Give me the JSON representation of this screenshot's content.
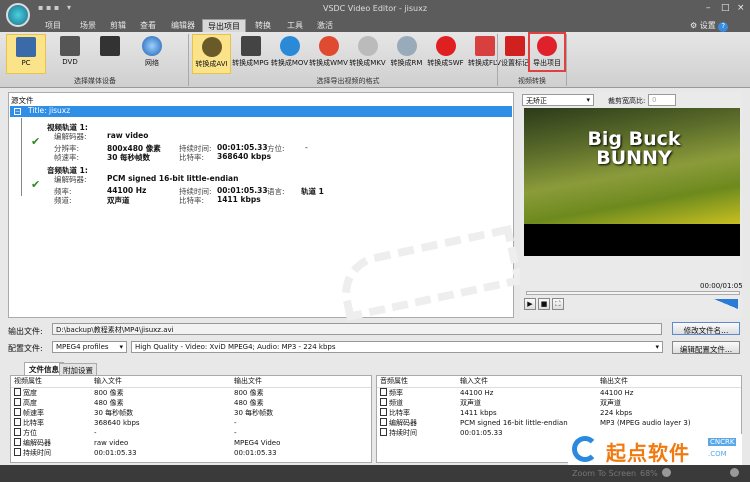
{
  "app": {
    "title": "VSDC Video Editor - jisuxz",
    "settings_label": "设置"
  },
  "menu_tabs": [
    "项目",
    "场景",
    "剪辑",
    "查看",
    "编辑器",
    "导出项目",
    "转换",
    "工具",
    "激活"
  ],
  "active_tab": "导出项目",
  "ribbon": {
    "devices": [
      "PC",
      "DVD",
      "",
      "网络"
    ],
    "devices_group": "选择媒体设备",
    "formats": [
      "转换成AVI",
      "转换成MPG",
      "转换成MOV",
      "转换成WMV",
      "转换成MKV",
      "转换成RM",
      "转换成SWF",
      "转换成FLV"
    ],
    "formats_group": "选择导出视频的格式",
    "actions": [
      "设置标记",
      "导出项目"
    ],
    "actions_group": "视频转换"
  },
  "source": {
    "header": "源文件",
    "title": "Title: jisuxz",
    "video_track": "视频轨道 1:",
    "video": {
      "codec_label": "编解码器:",
      "codec": "raw video",
      "res_label": "分辨率:",
      "res": "800x480 像素",
      "dur_label": "持续时间:",
      "dur": "00:01:05.33",
      "orient_label": "方位:",
      "orient": "-",
      "fps_label": "帧速率:",
      "fps": "30 每秒帧数",
      "bitrate_label": "比特率:",
      "bitrate": "368640 kbps"
    },
    "audio_track": "音频轨道 1:",
    "audio": {
      "codec_label": "编解码器:",
      "codec": "PCM signed 16-bit little-endian",
      "freq_label": "频率:",
      "freq": "44100 Hz",
      "dur_label": "持续时间:",
      "dur": "00:01:05.33",
      "lang_label": "语言:",
      "lang": "轨道 1",
      "ch_label": "频道:",
      "ch": "双声道",
      "bitrate_label": "比特率:",
      "bitrate": "1411 kbps"
    }
  },
  "preview": {
    "mode": "无矫正",
    "crop_label": "裁剪宽高比:",
    "crop_value": "0",
    "video_title": "Big Buck BUNNY",
    "time": "00:00/01:05"
  },
  "output": {
    "file_label": "输出文件:",
    "file_value": "D:\\backup\\教程素材\\MP4\\jisuxz.avi",
    "rename_button": "修改文件名...",
    "profile_label": "配置文件:",
    "profile": "MPEG4 profiles",
    "preset": "High Quality - Video: XviD MPEG4; Audio: MP3 - 224 kbps",
    "edit_profile_button": "编辑配置文件..."
  },
  "info_tabs": [
    "文件信息",
    "附加设置"
  ],
  "video_table": {
    "headers": [
      "视频属性",
      "输入文件",
      "输出文件"
    ],
    "rows": [
      [
        "宽度",
        "800 像素",
        "800 像素"
      ],
      [
        "高度",
        "480 像素",
        "480 像素"
      ],
      [
        "帧速率",
        "30 每秒帧数",
        "30 每秒帧数"
      ],
      [
        "比特率",
        "368640 kbps",
        "-"
      ],
      [
        "方位",
        "-",
        "-"
      ],
      [
        "编解码器",
        "raw video",
        "MPEG4 Video"
      ],
      [
        "持续时间",
        "00:01:05.33",
        "00:01:05.33"
      ]
    ]
  },
  "audio_table": {
    "headers": [
      "音频属性",
      "输入文件",
      "输出文件"
    ],
    "rows": [
      [
        "频率",
        "44100 Hz",
        "44100 Hz"
      ],
      [
        "频道",
        "双声道",
        "双声道"
      ],
      [
        "比特率",
        "1411 kbps",
        "224 kbps"
      ],
      [
        "编解码器",
        "PCM signed 16-bit little-endian",
        "MP3 (MPEG audio layer 3)"
      ],
      [
        "持续时间",
        "00:01:05.33",
        ""
      ]
    ]
  },
  "status": {
    "zoom_label": "Zoom To Screen",
    "zoom_value": "68%"
  },
  "watermark": "起点软件 CNCRK.COM",
  "colors": {
    "accent": "#1e7fe0",
    "export_highlight": "#e0202a"
  }
}
